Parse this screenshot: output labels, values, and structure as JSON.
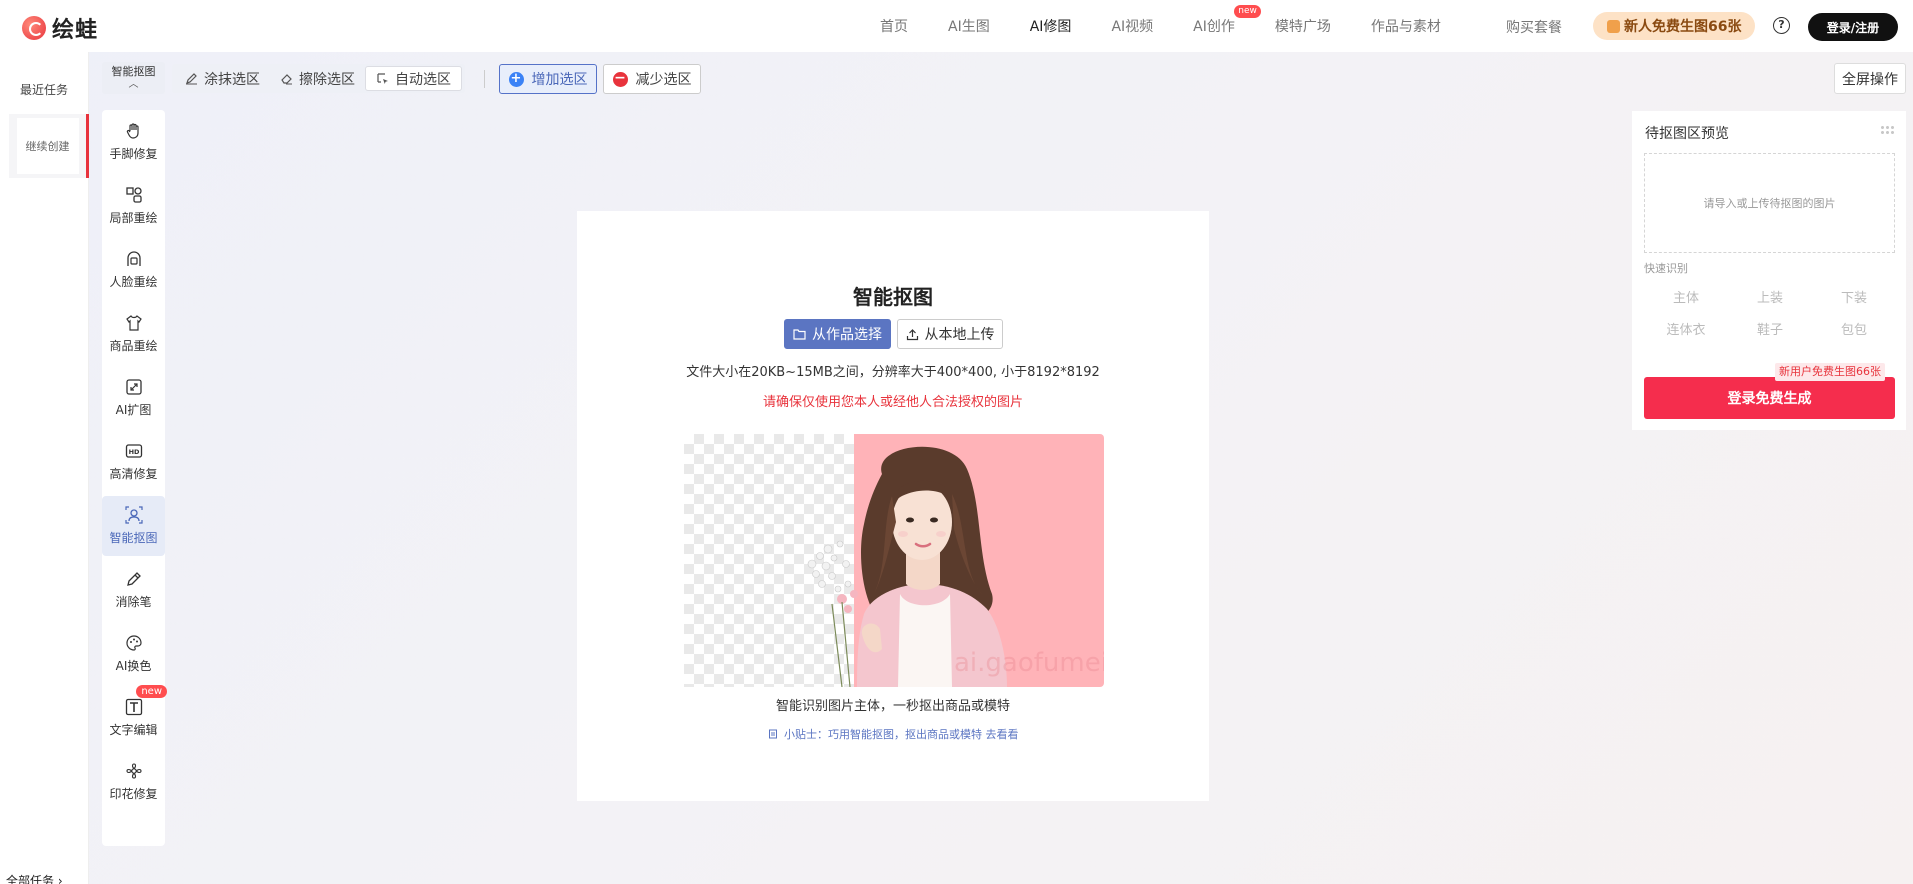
{
  "brand": {
    "name": "绘蛙"
  },
  "nav": {
    "items": [
      {
        "label": "首页",
        "active": false
      },
      {
        "label": "AI生图",
        "active": false
      },
      {
        "label": "AI修图",
        "active": true
      },
      {
        "label": "AI视频",
        "active": false
      },
      {
        "label": "AI创作",
        "active": false,
        "badge": "new"
      },
      {
        "label": "模特广场",
        "active": false
      },
      {
        "label": "作品与素材",
        "active": false
      }
    ],
    "buy": "购买套餐",
    "promo": "新人免费生图66张",
    "help": "?",
    "login": "登录/注册"
  },
  "tasks": {
    "recent": "最近任务",
    "continue": "继续创建",
    "all": "全部任务"
  },
  "tools": [
    {
      "label": "手脚修复",
      "icon": "hand-icon"
    },
    {
      "label": "局部重绘",
      "icon": "shapes-icon"
    },
    {
      "label": "人脸重绘",
      "icon": "face-icon"
    },
    {
      "label": "商品重绘",
      "icon": "shirt-icon"
    },
    {
      "label": "AI扩图",
      "icon": "expand-icon"
    },
    {
      "label": "高清修复",
      "icon": "hd-icon"
    },
    {
      "label": "智能抠图",
      "icon": "cutout-icon",
      "active": true
    },
    {
      "label": "消除笔",
      "icon": "eraser-pen-icon"
    },
    {
      "label": "AI换色",
      "icon": "palette-icon"
    },
    {
      "label": "文字编辑",
      "icon": "text-icon",
      "badge": "new"
    },
    {
      "label": "印花修复",
      "icon": "flower-icon"
    }
  ],
  "toolbar": {
    "mode": "智能抠图",
    "paint": "涂抹选区",
    "erase": "擦除选区",
    "auto": "自动选区",
    "add": "增加选区",
    "subtract": "减少选区",
    "fullscreen": "全屏操作"
  },
  "card": {
    "title": "智能抠图",
    "pick": "从作品选择",
    "upload": "从本地上传",
    "requirements": "文件大小在20KB~15MB之间，分辨率大于400*400, 小于8192*8192",
    "warning": "请确保仅使用您本人或经他人合法授权的图片",
    "watermark": "ai.gaofumei.net",
    "caption": "智能识别图片主体，一秒抠出商品或模特",
    "tip": "小贴士：巧用智能抠图，抠出商品或模特 去看看"
  },
  "panel": {
    "title": "待抠图区预览",
    "placeholder": "请导入或上传待抠图的图片",
    "quick_label": "快速识别",
    "chips": [
      "主体",
      "上装",
      "下装",
      "连体衣",
      "鞋子",
      "包包"
    ],
    "newbie": "新用户免费生图66张",
    "generate": "登录免费生成"
  },
  "colors": {
    "accent": "#5b75c2",
    "brand_red": "#f52d4d",
    "promo_bg": "#fde2c6",
    "demo_bg": "#ffb3b8"
  }
}
